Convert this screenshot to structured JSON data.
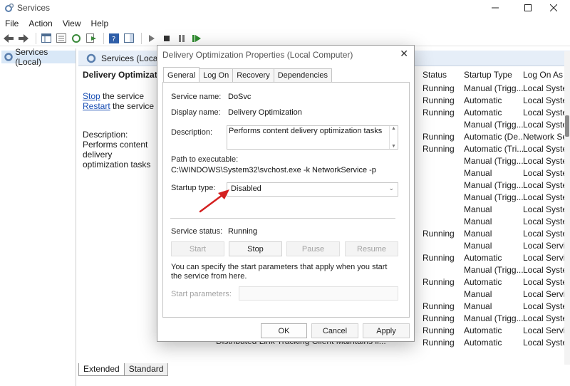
{
  "window": {
    "title": "Services"
  },
  "menu": [
    "File",
    "Action",
    "View",
    "Help"
  ],
  "tree": {
    "root_label": "Services (Local)"
  },
  "pane": {
    "header": "Services (Local)",
    "selected_service": "Delivery Optimization",
    "stop_link": "Stop",
    "stop_rest": " the service",
    "restart_link": "Restart",
    "restart_rest": " the service",
    "description_label": "Description:",
    "description_text": "Performs content delivery optimization tasks"
  },
  "columns": {
    "status": "Status",
    "startup": "Startup Type",
    "logon": "Log On As"
  },
  "rows": [
    {
      "status": "Running",
      "startup": "Manual (Trigg...",
      "logon": "Local Syster"
    },
    {
      "status": "Running",
      "startup": "Automatic",
      "logon": "Local Syster"
    },
    {
      "status": "Running",
      "startup": "Automatic",
      "logon": "Local Syster"
    },
    {
      "status": "",
      "startup": "Manual (Trigg...",
      "logon": "Local Syster"
    },
    {
      "status": "Running",
      "startup": "Automatic (De...",
      "logon": "Network Se"
    },
    {
      "status": "Running",
      "startup": "Automatic (Tri...",
      "logon": "Local Syster"
    },
    {
      "status": "",
      "startup": "Manual (Trigg...",
      "logon": "Local Syster"
    },
    {
      "status": "",
      "startup": "Manual",
      "logon": "Local Syster"
    },
    {
      "status": "",
      "startup": "Manual (Trigg...",
      "logon": "Local Syster"
    },
    {
      "status": "",
      "startup": "Manual (Trigg...",
      "logon": "Local Syster"
    },
    {
      "status": "",
      "startup": "Manual",
      "logon": "Local Syster"
    },
    {
      "status": "",
      "startup": "Manual",
      "logon": "Local Syster"
    },
    {
      "status": "Running",
      "startup": "Manual",
      "logon": "Local Syster"
    },
    {
      "status": "",
      "startup": "Manual",
      "logon": "Local Servic"
    },
    {
      "status": "Running",
      "startup": "Automatic",
      "logon": "Local Servic"
    },
    {
      "status": "",
      "startup": "Manual (Trigg...",
      "logon": "Local Syster"
    },
    {
      "status": "Running",
      "startup": "Automatic",
      "logon": "Local Syster"
    },
    {
      "status": "",
      "startup": "Manual",
      "logon": "Local Servic"
    },
    {
      "status": "Running",
      "startup": "Manual",
      "logon": "Local Syster"
    },
    {
      "status": "Running",
      "startup": "Manual (Trigg...",
      "logon": "Local Syster"
    },
    {
      "status": "Running",
      "startup": "Automatic",
      "logon": "Local Servic"
    },
    {
      "status": "Running",
      "startup": "Automatic",
      "logon": "Local Syster"
    }
  ],
  "bottom_row_text": "Distributed Link Tracking Client     Maintains li...",
  "bottom_tabs": [
    "Extended",
    "Standard"
  ],
  "dialog": {
    "title": "Delivery Optimization Properties (Local Computer)",
    "close": "✕",
    "tabs": [
      "General",
      "Log On",
      "Recovery",
      "Dependencies"
    ],
    "service_name_label": "Service name:",
    "service_name": "DoSvc",
    "display_name_label": "Display name:",
    "display_name": "Delivery Optimization",
    "description_label": "Description:",
    "description": "Performs content delivery optimization tasks",
    "path_label": "Path to executable:",
    "path": "C:\\WINDOWS\\System32\\svchost.exe -k NetworkService -p",
    "startup_label": "Startup type:",
    "startup_value": "Disabled",
    "status_label": "Service status:",
    "status_value": "Running",
    "btn_start": "Start",
    "btn_stop": "Stop",
    "btn_pause": "Pause",
    "btn_resume": "Resume",
    "hint": "You can specify the start parameters that apply when you start the service from here.",
    "params_label": "Start parameters:",
    "ok": "OK",
    "cancel": "Cancel",
    "apply": "Apply"
  },
  "colors": {
    "annotation_arrow": "#d42020",
    "link": "#1a4fb4",
    "header_bg": "#e6eef8"
  }
}
